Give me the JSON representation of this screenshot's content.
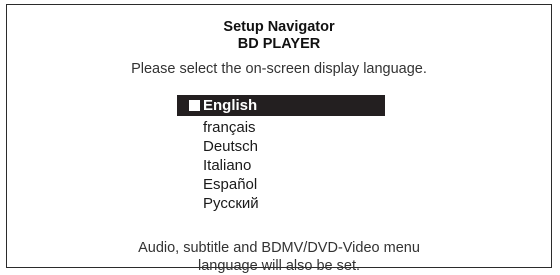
{
  "header": {
    "title": "Setup Navigator",
    "subtitle": "BD PLAYER",
    "prompt": "Please select the on-screen display language."
  },
  "languages": [
    {
      "label": "English",
      "selected": true
    },
    {
      "label": "français",
      "selected": false
    },
    {
      "label": "Deutsch",
      "selected": false
    },
    {
      "label": "Italiano",
      "selected": false
    },
    {
      "label": "Español",
      "selected": false
    },
    {
      "label": "Русский",
      "selected": false
    }
  ],
  "footer": {
    "line1": "Audio, subtitle and BDMV/DVD-Video menu",
    "line2": "language will also be set."
  },
  "colors": {
    "highlight_bg": "#231f20",
    "highlight_text": "#ffffff",
    "text": "#1a1a1a"
  }
}
